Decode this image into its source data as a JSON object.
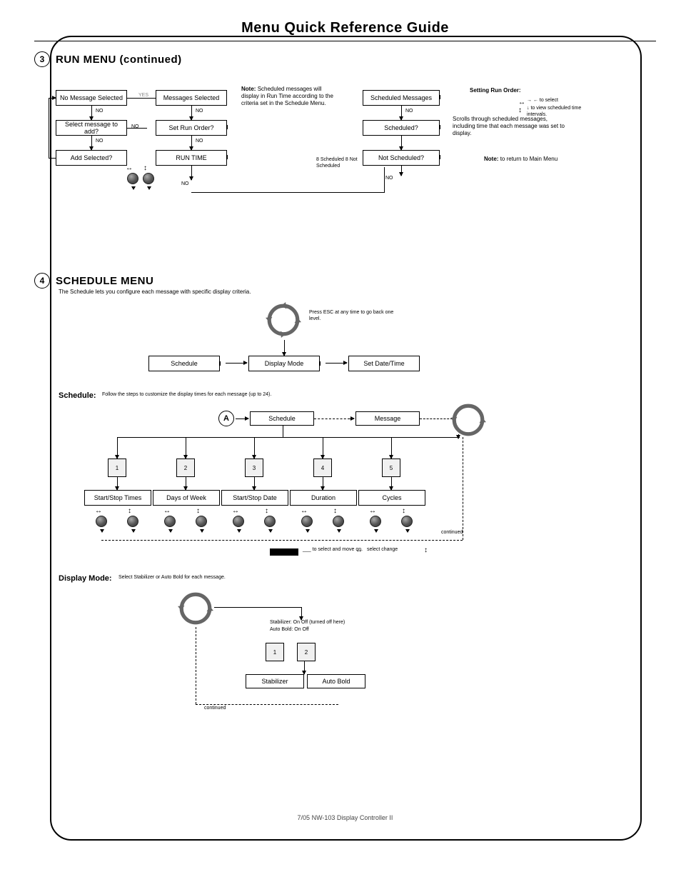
{
  "header": {
    "title": "Menu Quick Reference Guide"
  },
  "footer": {
    "text": "7/05                                              NW-103 Display Controller II"
  },
  "section3": {
    "num": "3",
    "title": "RUN MENU (continued)",
    "note1_title": "Note:",
    "note1_body": "Scheduled messages will display in Run Time according to the criteria set in the Schedule Menu.",
    "sidebar_title": "Setting Run Order:",
    "sidebar_lines": [
      "→ ← to select",
      "↓ to view scheduled time intervals."
    ],
    "nodes": {
      "left1": "No Message Selected",
      "left2": "Select message to add?",
      "left3": "Add Selected?",
      "mid1": "Messages Selected",
      "mid2": "Set Run Order?",
      "mid3": "RUN TIME",
      "right1": "Scheduled Messages",
      "right2": "Scheduled?",
      "right3": "Not Scheduled?"
    },
    "labels": {
      "no": "NO",
      "yes": "YES",
      "yes_gray": "YES"
    },
    "anno1": "Scrolls through scheduled messages, including time that each message was set to display.",
    "anno2": "8 Scheduled 8 Not Scheduled",
    "bottom_note": " to return to Main Menu"
  },
  "section4": {
    "num": "4",
    "title": "SCHEDULE MENU",
    "intro": "The <b>Schedule</b> lets you configure each message with specific display criteria.",
    "nodes": {
      "a": "Schedule",
      "b": "Display Mode",
      "c": "Set Date/Time"
    },
    "recycle_note": "Press ESC at any time to go back one level.",
    "sub_schedule": {
      "start": "A",
      "n1": "Schedule",
      "n2": "Message",
      "sq_labels": [
        "1",
        "2",
        "3",
        "4",
        "5"
      ],
      "rows": [
        "Start/Stop Times",
        "Days of Week",
        "Start/Stop Date",
        "Duration",
        "Cycles"
      ],
      "pair_note": "select         change",
      "bottom": "___ to select and move on.",
      "cont": "continued"
    },
    "sub_display": {
      "label": "Display Mode",
      "line1": "Stabilizer:  On   Off (turned off here)",
      "line2": "Auto Bold:  On   Off",
      "sq": [
        "1",
        "2"
      ],
      "r1": "Stabilizer",
      "r2": "Auto Bold",
      "cont": "continued"
    }
  }
}
